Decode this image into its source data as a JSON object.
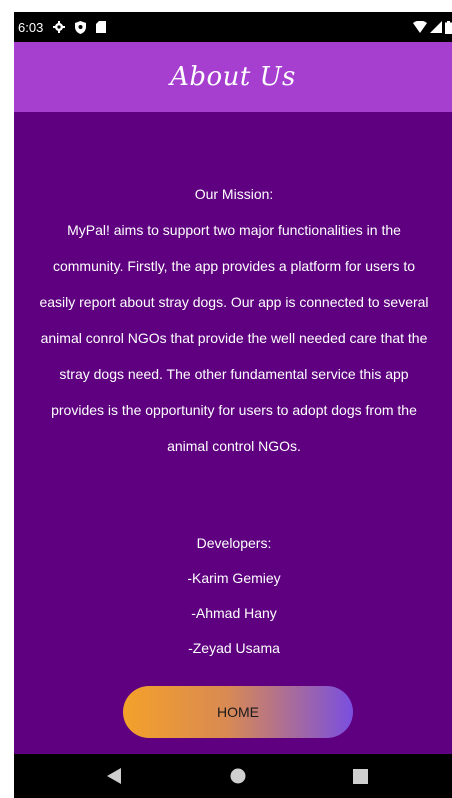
{
  "status_bar": {
    "time": "6:03",
    "left_icons": [
      "settings-icon",
      "shield-icon",
      "sd-card-icon"
    ],
    "right_icons": [
      "wifi-icon",
      "signal-icon",
      "battery-icon"
    ]
  },
  "app_bar": {
    "title": "About Us"
  },
  "mission": {
    "heading": "Our Mission:",
    "body": "MyPal! aims to support two major functionalities in the community. Firstly, the app provides a platform for users to easily report about stray dogs. Our app is connected to several animal conrol NGOs that provide the well needed care that the stray dogs need. The other fundamental service this app provides is the opportunity for users to adopt dogs from the animal control NGOs."
  },
  "developers": {
    "heading": "Developers:",
    "names": [
      "-Karim Gemiey",
      "-Ahmad Hany",
      "-Zeyad Usama"
    ]
  },
  "home_button": {
    "label": "HOME"
  },
  "nav_bar": {
    "buttons": [
      "back-icon",
      "home-icon",
      "recents-icon"
    ]
  },
  "colors": {
    "background": "#5e0080",
    "app_bar": "#a63fcf",
    "button_gradient_start": "#f4a12a",
    "button_gradient_end": "#7a4fe0"
  }
}
